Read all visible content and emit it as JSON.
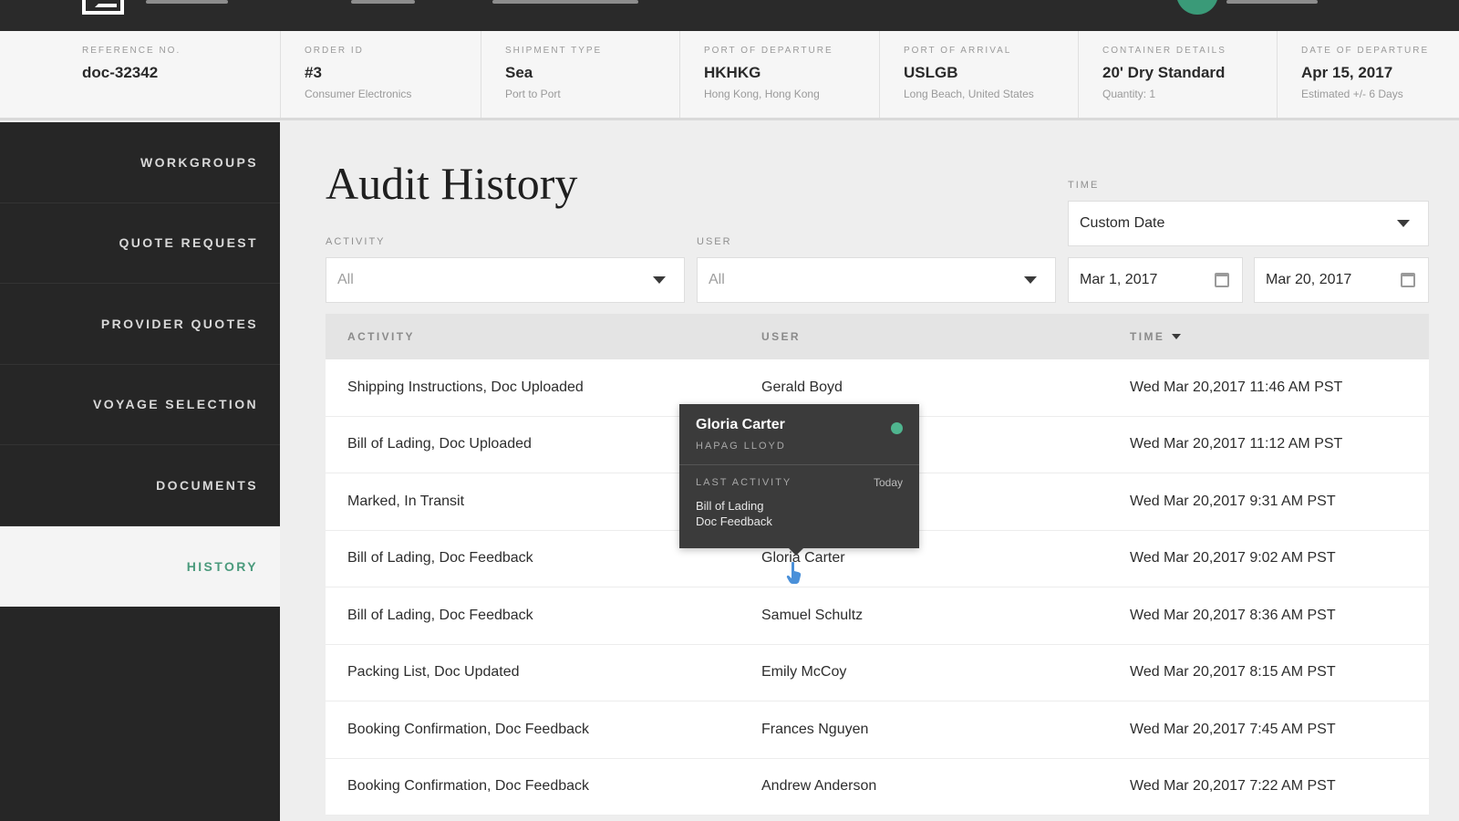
{
  "info": [
    {
      "label": "REFERENCE NO.",
      "value": "doc-32342",
      "sub": ""
    },
    {
      "label": "ORDER ID",
      "value": "#3",
      "sub": "Consumer Electronics"
    },
    {
      "label": "SHIPMENT TYPE",
      "value": "Sea",
      "sub": "Port to Port"
    },
    {
      "label": "PORT OF DEPARTURE",
      "value": "HKHKG",
      "sub": "Hong Kong, Hong Kong"
    },
    {
      "label": "PORT OF ARRIVAL",
      "value": "USLGB",
      "sub": "Long Beach, United States"
    },
    {
      "label": "CONTAINER DETAILS",
      "value": "20' Dry Standard",
      "sub": "Quantity: 1"
    },
    {
      "label": "DATE OF DEPARTURE",
      "value": "Apr 15, 2017",
      "sub": "Estimated +/- 6 Days"
    }
  ],
  "sidebar": {
    "items": [
      {
        "label": "WORKGROUPS",
        "active": false
      },
      {
        "label": "QUOTE REQUEST",
        "active": false
      },
      {
        "label": "PROVIDER QUOTES",
        "active": false
      },
      {
        "label": "VOYAGE SELECTION",
        "active": false
      },
      {
        "label": "DOCUMENTS",
        "active": false
      },
      {
        "label": "HISTORY",
        "active": true
      }
    ]
  },
  "page": {
    "title": "Audit History"
  },
  "filters": {
    "activity_label": "ACTIVITY",
    "activity_value": "All",
    "user_label": "USER",
    "user_value": "All",
    "time_label": "TIME",
    "time_value": "Custom Date",
    "date_from": "Mar 1, 2017",
    "date_to": "Mar 20, 2017"
  },
  "table": {
    "headers": {
      "activity": "ACTIVITY",
      "user": "USER",
      "time": "TIME"
    },
    "rows": [
      {
        "activity": "Shipping Instructions, Doc Uploaded",
        "user": "Gerald Boyd",
        "time": "Wed Mar 20,2017 11:46 AM PST"
      },
      {
        "activity": "Bill of Lading, Doc Uploaded",
        "user": "",
        "time": "Wed Mar 20,2017 11:12 AM PST"
      },
      {
        "activity": "Marked, In Transit",
        "user": "",
        "time": "Wed Mar 20,2017 9:31 AM PST"
      },
      {
        "activity": "Bill of Lading, Doc Feedback",
        "user": "Gloria Carter",
        "time": "Wed Mar 20,2017 9:02 AM PST"
      },
      {
        "activity": "Bill of Lading, Doc Feedback",
        "user": "Samuel Schultz",
        "time": "Wed Mar 20,2017 8:36 AM PST"
      },
      {
        "activity": "Packing List, Doc Updated",
        "user": "Emily McCoy",
        "time": "Wed Mar 20,2017 8:15 AM PST"
      },
      {
        "activity": "Booking Confirmation, Doc Feedback",
        "user": "Frances Nguyen",
        "time": "Wed Mar 20,2017 7:45 AM PST"
      },
      {
        "activity": "Booking Confirmation, Doc Feedback",
        "user": "Andrew Anderson",
        "time": "Wed Mar 20,2017 7:22 AM PST"
      }
    ]
  },
  "popover": {
    "name": "Gloria Carter",
    "company": "HAPAG LLOYD",
    "last_activity_label": "LAST ACTIVITY",
    "last_activity_when": "Today",
    "last_activity_text": "Bill of Lading\nDoc Feedback"
  },
  "colors": {
    "accent": "#4a9a7c",
    "status_online": "#4fb58f",
    "sidebar_bg": "#262626",
    "topbar_bg": "#2a2a2a"
  },
  "icons": {
    "logo": "app-logo-icon",
    "caret": "chevron-down-icon",
    "calendar": "calendar-icon",
    "cursor": "pointer-hand-icon",
    "status": "online-status-icon"
  }
}
